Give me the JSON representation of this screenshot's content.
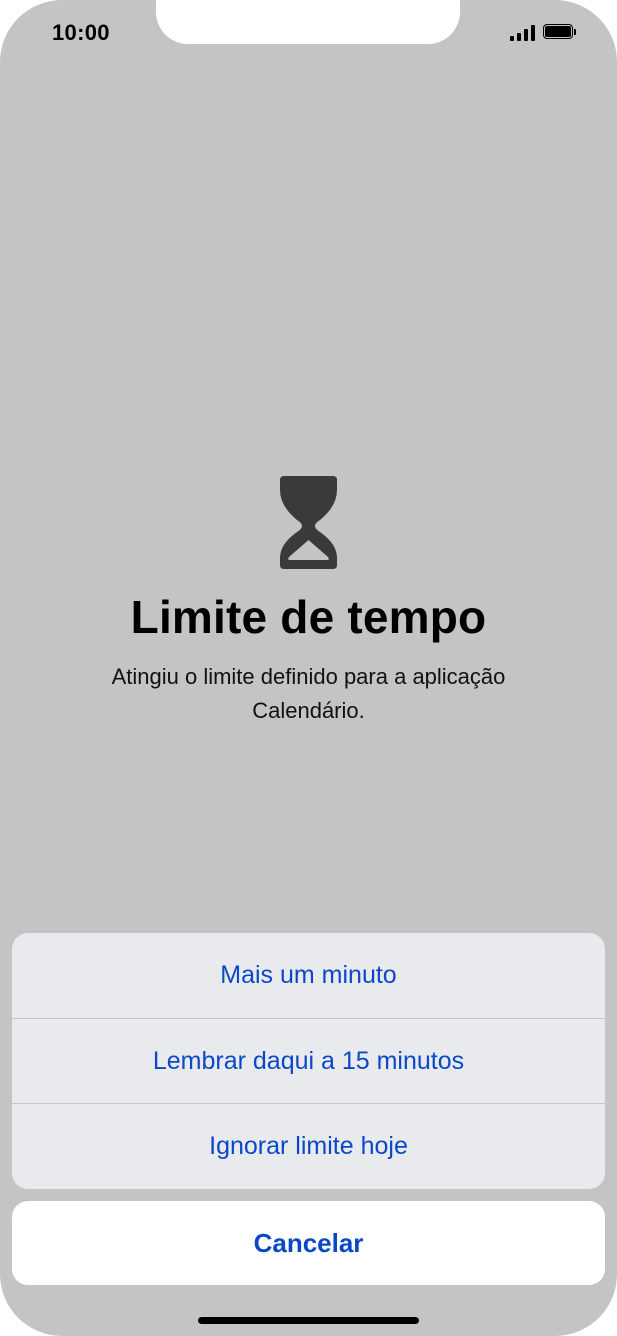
{
  "status_bar": {
    "time": "10:00",
    "signal_icon": "cellular-signal-icon",
    "battery_icon": "battery-icon"
  },
  "screen_time": {
    "icon": "hourglass-icon",
    "title": "Limite de tempo",
    "message": "Atingiu o limite definido para a aplicação Calendário."
  },
  "action_sheet": {
    "options": [
      {
        "label": "Mais um minuto"
      },
      {
        "label": "Lembrar daqui a 15 minutos"
      },
      {
        "label": "Ignorar limite hoje"
      }
    ],
    "cancel_label": "Cancelar"
  },
  "colors": {
    "background": "#c4c4c4",
    "action_text": "#0b48c8",
    "sheet_background": "#e9eaee"
  }
}
